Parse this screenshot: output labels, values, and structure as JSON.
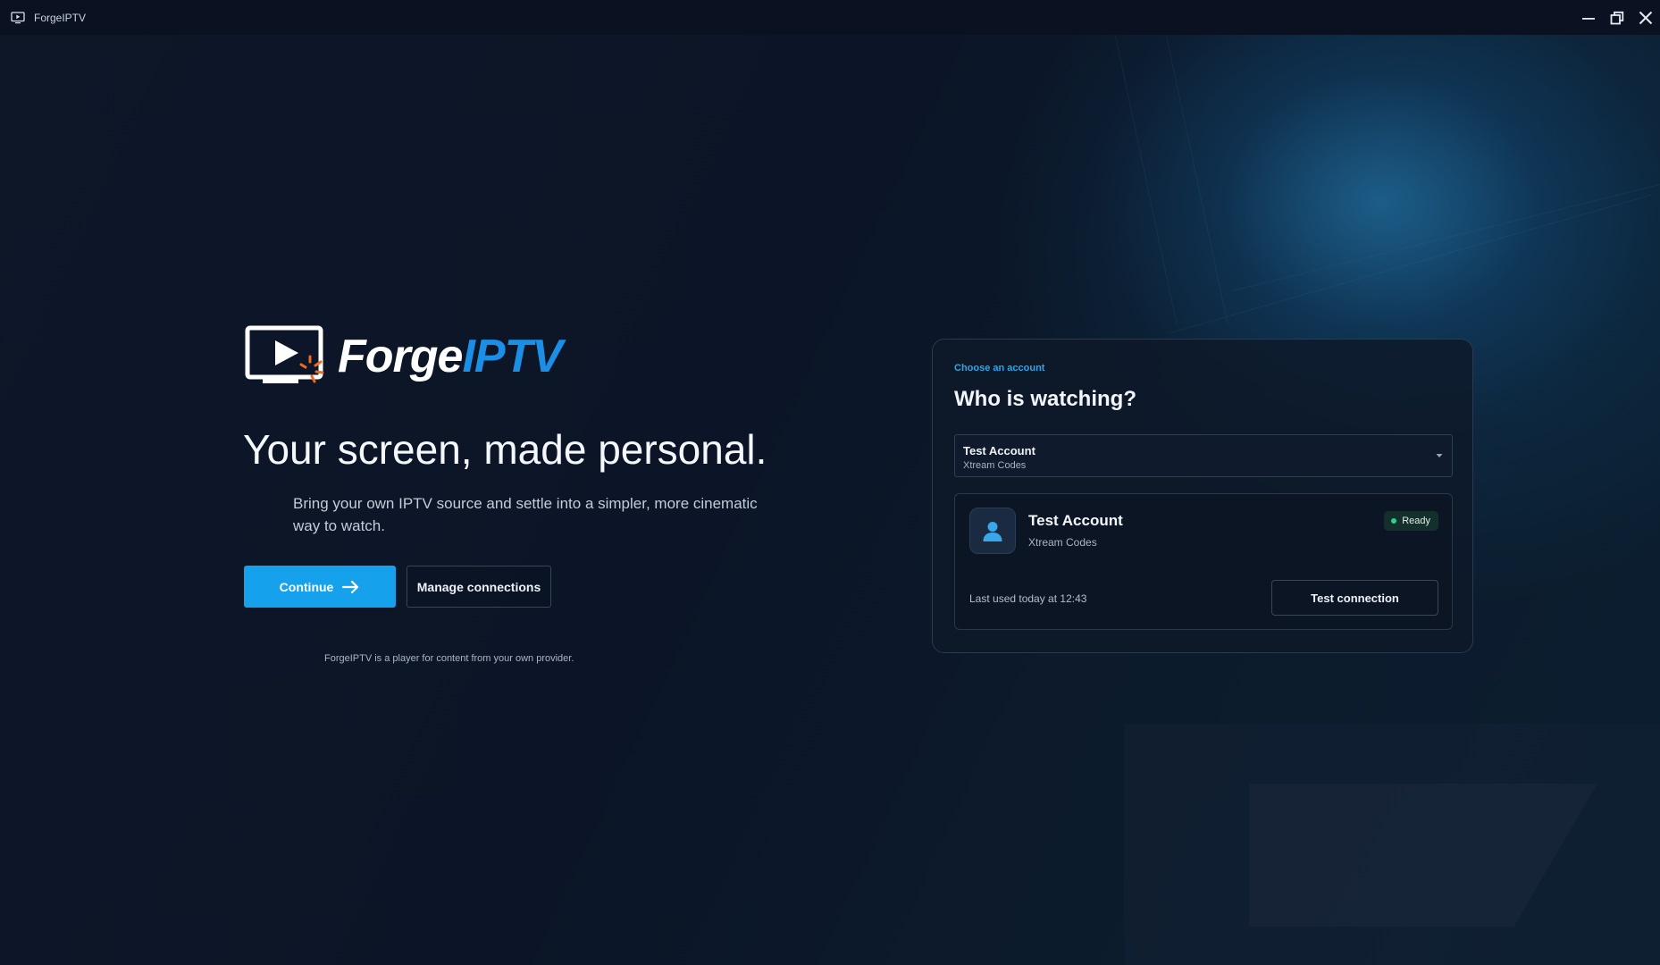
{
  "window": {
    "title": "ForgeIPTV",
    "controls": [
      "minimize-icon",
      "restore-icon",
      "close-icon"
    ]
  },
  "hero": {
    "logo_forge": "Forge",
    "logo_iptv": "IPTV",
    "headline": "Your screen, made personal.",
    "subtitle": "Bring your own IPTV source and settle into a simpler, more cinematic way to watch.",
    "continue_label": "Continue",
    "manage_label": "Manage connections",
    "footnote": "ForgeIPTV is a player for content from your own provider."
  },
  "account_card": {
    "eyebrow": "Choose an account",
    "title": "Who is watching?",
    "select": {
      "primary": "Test Account",
      "secondary": "Xtream Codes"
    },
    "account": {
      "name": "Test Account",
      "type": "Xtream Codes",
      "status": "Ready",
      "last_used": "Last used today at 12:43",
      "test_label": "Test connection"
    }
  },
  "colors": {
    "accent": "#16a1ec",
    "brand_blue": "#1b8fe6",
    "logo_spark": "#f26b1d",
    "status_ready": "#2fd08e",
    "background": "#0b1424"
  }
}
